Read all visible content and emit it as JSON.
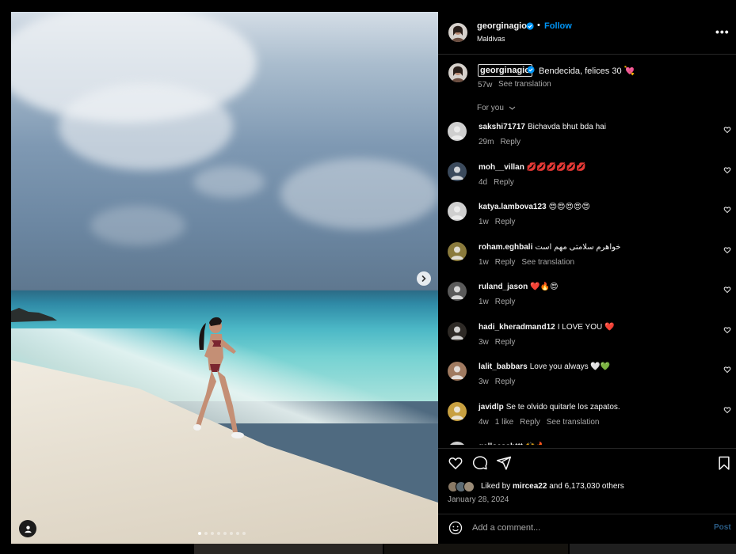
{
  "post": {
    "author": "georginagio",
    "follow_label": "Follow",
    "separator": "•",
    "location": "Maldivas",
    "more_label": "•••",
    "caption": "Bendecida, felices 30 💘",
    "caption_time": "57w",
    "see_translation": "See translation",
    "photo_index": 1,
    "photo_count": 8
  },
  "sort_label": "For you",
  "comments": [
    {
      "user": "sakshi71717",
      "text": "Bichavda bhut bda hai",
      "time": "29m",
      "reply": "Reply",
      "translate": ""
    },
    {
      "user": "moh__villan",
      "text": "💋💋💋💋💋💋",
      "time": "4d",
      "reply": "Reply",
      "translate": ""
    },
    {
      "user": "katya.lambova123",
      "text": "😍😍😍😍😍",
      "time": "1w",
      "reply": "Reply",
      "translate": ""
    },
    {
      "user": "roham.eghbali",
      "text": "خواهرم سلامتی مهم است",
      "time": "1w",
      "reply": "Reply",
      "translate": "See translation"
    },
    {
      "user": "ruland_jason",
      "text": "❤️🔥😍",
      "time": "1w",
      "reply": "Reply",
      "translate": ""
    },
    {
      "user": "hadi_kheradmand12",
      "text": "I LOVE YOU ❤️",
      "time": "3w",
      "reply": "Reply",
      "translate": ""
    },
    {
      "user": "lalit_babbars",
      "text": "Love you always 🤍💚",
      "time": "3w",
      "reply": "Reply",
      "translate": ""
    },
    {
      "user": "javidlp",
      "text": "Se te olvido quitarle los zapatos.",
      "time": "4w",
      "likes": "1 like",
      "reply": "Reply",
      "translate": "See translation"
    },
    {
      "user": "gelloesshttt",
      "text": "🙌🔥",
      "time": "",
      "reply": "",
      "translate": ""
    }
  ],
  "likes": {
    "prefix": "Liked by",
    "user": "mircea22",
    "suffix": "and 6,173,030 others"
  },
  "post_date": "January 28, 2024",
  "comment_input": {
    "placeholder": "Add a comment..."
  },
  "post_button": "Post",
  "colors": {
    "link_blue": "#0095f6",
    "muted": "#a8a8a8",
    "panel_bg": "#000000"
  }
}
